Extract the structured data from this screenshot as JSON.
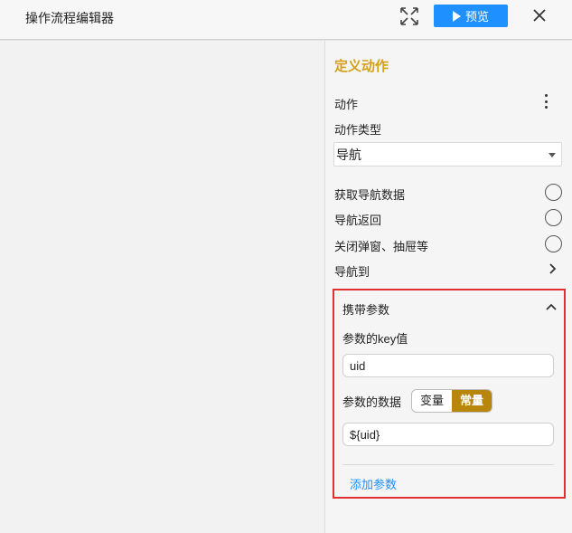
{
  "header": {
    "title": "操作流程编辑器",
    "preview_label": "预览",
    "icons": {
      "expand": "expand-icon",
      "close": "close-icon",
      "play": "play-icon"
    }
  },
  "panel": {
    "title": "定义动作",
    "action_label": "动作",
    "action_type_label": "动作类型",
    "action_type_value": "导航",
    "options": [
      {
        "label": "获取导航数据",
        "selected": false
      },
      {
        "label": "导航返回",
        "selected": false
      },
      {
        "label": "关闭弹窗、抽屉等",
        "selected": false
      }
    ],
    "navigate_to_label": "导航到",
    "params": {
      "title": "携带参数",
      "key_label": "参数的key值",
      "key_value": "uid",
      "data_label": "参数的数据",
      "toggle": {
        "variable": "变量",
        "constant": "常量",
        "active": "constant"
      },
      "data_value": "${uid}",
      "add_label": "添加参数"
    }
  },
  "colors": {
    "accent": "#d4a017",
    "primary": "#1e90ff",
    "highlight_border": "#e03030",
    "toggle_active": "#b8860b"
  }
}
